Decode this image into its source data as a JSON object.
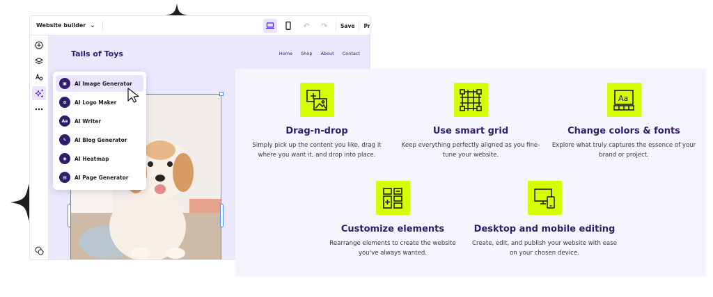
{
  "topbar": {
    "site_selector": "Website builder",
    "save_label": "Save",
    "preview_label": "Preview"
  },
  "site": {
    "logo": "Tails of Toys",
    "nav": [
      "Home",
      "Shop",
      "About",
      "Contact"
    ]
  },
  "ai_menu": {
    "items": [
      {
        "label": "AI Image Generator",
        "icon": "image-plus-icon",
        "active": true
      },
      {
        "label": "AI Logo Maker",
        "icon": "logo-icon",
        "active": false
      },
      {
        "label": "AI Writer",
        "icon": "text-icon",
        "active": false
      },
      {
        "label": "AI Blog Generator",
        "icon": "blog-icon",
        "active": false
      },
      {
        "label": "AI Heatmap",
        "icon": "heatmap-icon",
        "active": false
      },
      {
        "label": "AI Page Generator",
        "icon": "page-icon",
        "active": false
      }
    ]
  },
  "features": [
    {
      "title": "Drag-n-drop",
      "desc": "Simply pick up the content you like, drag it\nwhere you want it, and drop into place.",
      "icon": "drag-drop-icon"
    },
    {
      "title": "Use smart grid",
      "desc": "Keep everything perfectly aligned as you fine-\ntune your website.",
      "icon": "grid-icon"
    },
    {
      "title": "Change colors & fonts",
      "desc": "Explore what truly captures the essence of your\nbrand or project.",
      "icon": "font-color-icon"
    },
    {
      "title": "Customize elements",
      "desc": "Rearrange elements to create the website\nyou've always wanted.",
      "icon": "elements-icon"
    },
    {
      "title": "Desktop and mobile editing",
      "desc": "Create, edit, and publish your website with ease\non your chosen device.",
      "icon": "devices-icon"
    }
  ],
  "colors": {
    "accent": "#d5ff00",
    "brand_purple": "#2f1c6a",
    "selection_blue": "#4a8df8",
    "panel_bg": "#f4f5ff",
    "canvas_bg": "#e9e8fd"
  }
}
